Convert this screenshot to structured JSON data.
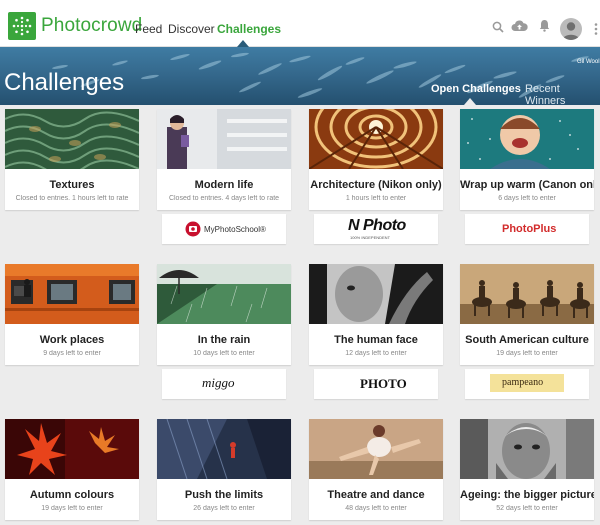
{
  "brand": {
    "name": "Photocrowd",
    "color": "#3aa63c"
  },
  "nav": {
    "items": [
      {
        "label": "Feed"
      },
      {
        "label": "Discover"
      },
      {
        "label": "Challenges",
        "active": true
      }
    ]
  },
  "top_icons": [
    "search-icon",
    "cloud-upload-icon",
    "bell-icon",
    "avatar",
    "more-vertical-icon"
  ],
  "banner": {
    "title": "Challenges",
    "tabs": [
      {
        "label": "Open Challenges",
        "active": true
      },
      {
        "label": "Recent Winners",
        "active": false
      }
    ],
    "credit": "Gil Wool"
  },
  "challenges": [
    {
      "title": "Textures",
      "status": "Closed to entries. 1 hours left to rate"
    },
    {
      "title": "Modern life",
      "status": "Closed to entries. 4 days left to rate"
    },
    {
      "title": "Architecture (Nikon only)",
      "status": "1 hours left to enter"
    },
    {
      "title": "Wrap up warm (Canon only)",
      "status": "6 days left to enter"
    },
    {
      "title": "Work places",
      "status": "9 days left to enter"
    },
    {
      "title": "In the rain",
      "status": "10 days left to enter"
    },
    {
      "title": "The human face",
      "status": "12 days left to enter"
    },
    {
      "title": "South American culture",
      "status": "19 days left to enter"
    },
    {
      "title": "Autumn colours",
      "status": "19 days left to enter"
    },
    {
      "title": "Push the limits",
      "status": "26 days left to enter"
    },
    {
      "title": "Theatre and dance",
      "status": "48 days left to enter"
    },
    {
      "title": "Ageing: the bigger picture",
      "status": "52 days left to enter"
    }
  ],
  "sponsors": [
    {
      "label": "MyPhotoSchool®"
    },
    {
      "label": "N Photo",
      "tagline": "100% INDEPENDENT"
    },
    {
      "label": "PhotoPlus"
    },
    {
      "label": "miggo"
    },
    {
      "label": "PHOTO"
    },
    {
      "label": "pampeano"
    }
  ]
}
